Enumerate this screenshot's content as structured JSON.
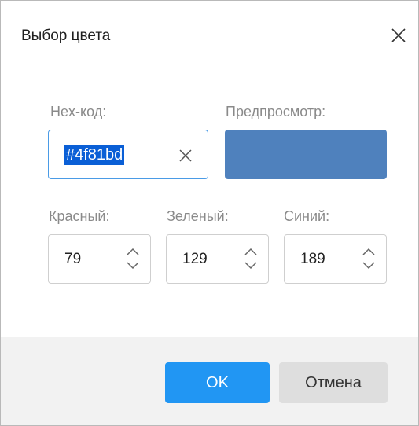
{
  "dialog": {
    "title": "Выбор цвета"
  },
  "hex": {
    "label": "Hex-код:",
    "value": "#4f81bd"
  },
  "preview": {
    "label": "Предпросмотр:",
    "color": "#4f81bd"
  },
  "rgb": {
    "red": {
      "label": "Красный:",
      "value": "79"
    },
    "green": {
      "label": "Зеленый:",
      "value": "129"
    },
    "blue": {
      "label": "Синий:",
      "value": "189"
    }
  },
  "buttons": {
    "ok": "OK",
    "cancel": "Отмена"
  },
  "colors": {
    "accent": "#2196f3",
    "focus_border": "#4a9be6",
    "selection": "#0a5fd6"
  },
  "icons": {
    "close": "close-icon",
    "clear": "clear-icon",
    "up": "chevron-up-icon",
    "down": "chevron-down-icon"
  }
}
